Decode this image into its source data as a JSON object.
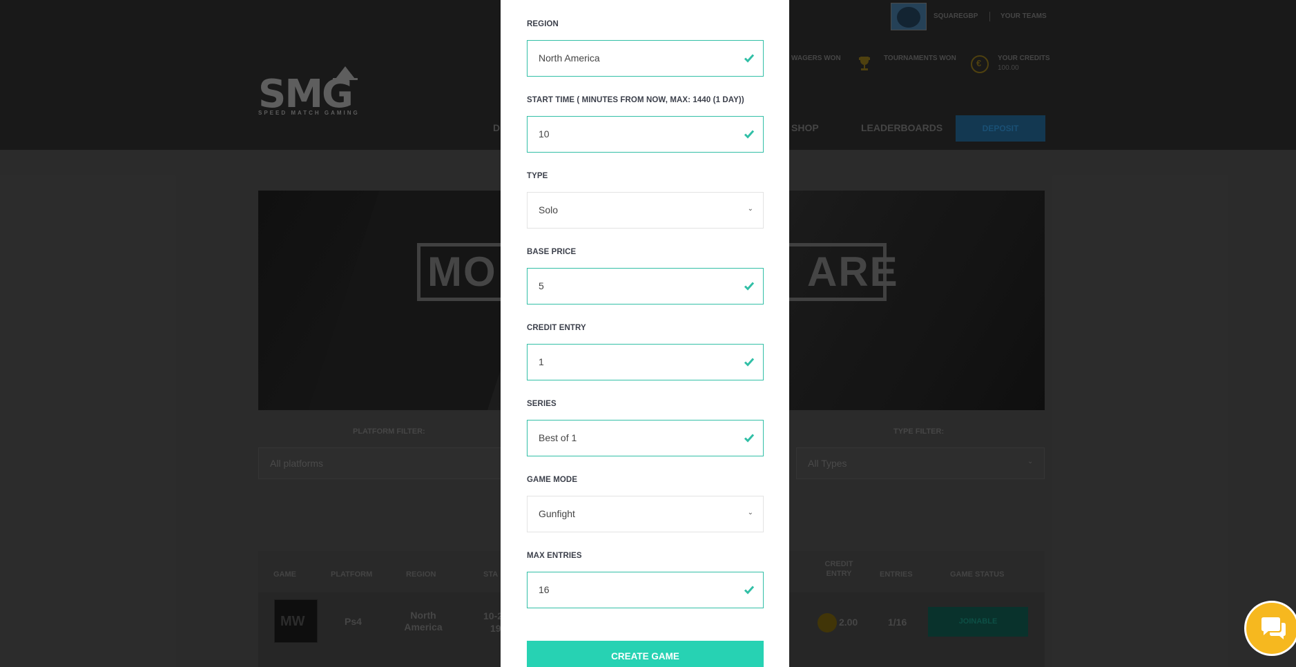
{
  "header": {
    "logo_text": "SMG",
    "logo_subtitle": "SPEED MATCH GAMING",
    "username": "SQUAREGBP",
    "your_teams": "YOUR TEAMS",
    "wagers_won": "WAGERS WON",
    "tournaments_won": "TOURNAMENTS WON",
    "your_credits_label": "YOUR CREDITS",
    "your_credits_value": "100.00",
    "nav": {
      "partial": "D",
      "shop": "SHOP",
      "leaderboards": "LEADERBOARDS",
      "deposit": "DEPOSIT"
    }
  },
  "banner": {
    "left_text": "MO",
    "right_text": "ARE"
  },
  "filters": {
    "platform_label": "PLATFORM FILTER:",
    "platform_value": "All platforms",
    "type_label": "TYPE FILTER:",
    "type_value": "All Types"
  },
  "table": {
    "headers": [
      "GAME",
      "PLATFORM",
      "REGION",
      "STA",
      "CREDIT ENTRY",
      "ENTRIES",
      "GAME STATUS"
    ],
    "row": {
      "platform": "Ps4",
      "region": "North America",
      "start_partial": "10-2",
      "start_partial2": "19",
      "credit": "2.00",
      "entries": "1/16",
      "status": "JOINABLE"
    }
  },
  "modal": {
    "fields": [
      {
        "label": "REGION",
        "value": "North America",
        "kind": "input"
      },
      {
        "label": "START TIME ( MINUTES FROM NOW, MAX: 1440 (1 DAY))",
        "value": "10",
        "kind": "input"
      },
      {
        "label": "TYPE",
        "value": "Solo",
        "kind": "select"
      },
      {
        "label": "BASE PRICE",
        "value": "5",
        "kind": "input"
      },
      {
        "label": "CREDIT ENTRY",
        "value": "1",
        "kind": "input"
      },
      {
        "label": "SERIES",
        "value": "Best of 1",
        "kind": "input"
      },
      {
        "label": "GAME MODE",
        "value": "Gunfight",
        "kind": "select"
      },
      {
        "label": "MAX ENTRIES",
        "value": "16",
        "kind": "input"
      }
    ],
    "submit_label": "CREATE GAME"
  },
  "icons": {
    "check": "check-icon",
    "chevron": "chevron-down-icon",
    "chat": "chat-icon",
    "trophy": "trophy-icon",
    "coin": "coin-icon"
  },
  "colors": {
    "accent": "#27d2b3",
    "valid_border": "#31bfa6",
    "chat": "#f6b81f"
  }
}
